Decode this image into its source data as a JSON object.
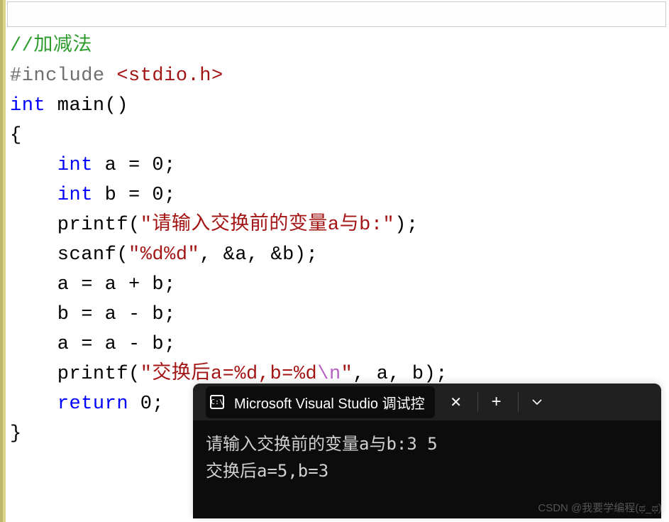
{
  "code": {
    "comment": "//加减法",
    "include_pre": "#include ",
    "include_hdr": "<stdio.h>",
    "kw_int": "int",
    "main_sig": " main()",
    "brace_open": "{",
    "decl_a_pre": "    ",
    "decl_a_rest": " a = 0;",
    "decl_b_rest": " b = 0;",
    "printf1_call": "    printf(",
    "printf1_str": "\"请输入交换前的变量a与b:\"",
    "printf1_end": ");",
    "scanf_call": "    scanf(",
    "scanf_str": "\"%d%d\"",
    "scanf_args": ", &a, &b);",
    "stmt1": "    a = a + b;",
    "stmt2": "    b = a - b;",
    "stmt3": "    a = a - b;",
    "printf2_call": "    printf(",
    "printf2_str1": "\"交换后a=%d,b=%d",
    "printf2_esc": "\\n",
    "printf2_str2": "\"",
    "printf2_args": ", a, b);",
    "return_kw": "return",
    "return_rest": " 0;",
    "brace_close": "}"
  },
  "terminal": {
    "tab_icon_text": "C:\\",
    "tab_label": "Microsoft Visual Studio 调试控",
    "line1": "请输入交换前的变量a与b:3 5",
    "line2": "交换后a=5,b=3"
  },
  "watermark": "CSDN @我要学编程(ಥ_ಥ)"
}
